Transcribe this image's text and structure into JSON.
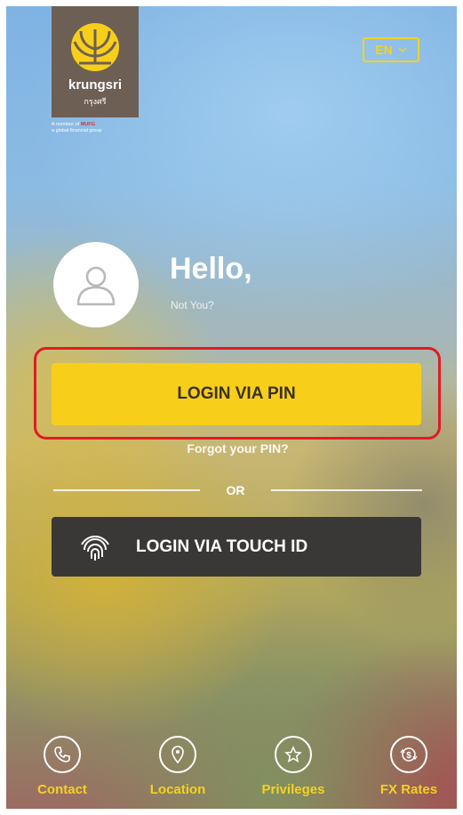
{
  "brand": {
    "name": "krungsri",
    "thai_name": "กรุงศรี",
    "tagline_prefix": "A member of",
    "tagline_mufg": "MUFG",
    "tagline_suffix": "a global financial group",
    "logo_color": "#6e5f55",
    "accent_color": "#f7cf1a"
  },
  "language": {
    "selected": "EN",
    "icon": "chevron-down-icon"
  },
  "profile": {
    "greeting": "Hello,",
    "not_you_link": "Not You?",
    "avatar_icon": "user-icon"
  },
  "login": {
    "pin_button_label": "LOGIN VIA PIN",
    "forgot_pin_link": "Forgot your PIN?",
    "divider_label": "OR",
    "touch_button_label": "LOGIN VIA TOUCH ID",
    "touch_icon": "fingerprint-icon",
    "highlight_color": "#e01b24"
  },
  "bottom_nav": {
    "items": [
      {
        "label": "Contact",
        "icon": "phone-icon"
      },
      {
        "label": "Location",
        "icon": "location-pin-icon"
      },
      {
        "label": "Privileges",
        "icon": "star-icon"
      },
      {
        "label": "FX Rates",
        "icon": "currency-exchange-icon"
      }
    ]
  }
}
